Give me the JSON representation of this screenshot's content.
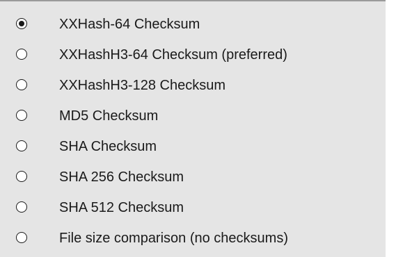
{
  "checksum_options": {
    "items": [
      {
        "label": "XXHash-64 Checksum",
        "selected": true
      },
      {
        "label": "XXHashH3-64 Checksum (preferred)",
        "selected": false
      },
      {
        "label": "XXHashH3-128 Checksum",
        "selected": false
      },
      {
        "label": "MD5 Checksum",
        "selected": false
      },
      {
        "label": "SHA Checksum",
        "selected": false
      },
      {
        "label": "SHA 256 Checksum",
        "selected": false
      },
      {
        "label": "SHA 512 Checksum",
        "selected": false
      },
      {
        "label": "File size comparison (no checksums)",
        "selected": false
      }
    ]
  }
}
